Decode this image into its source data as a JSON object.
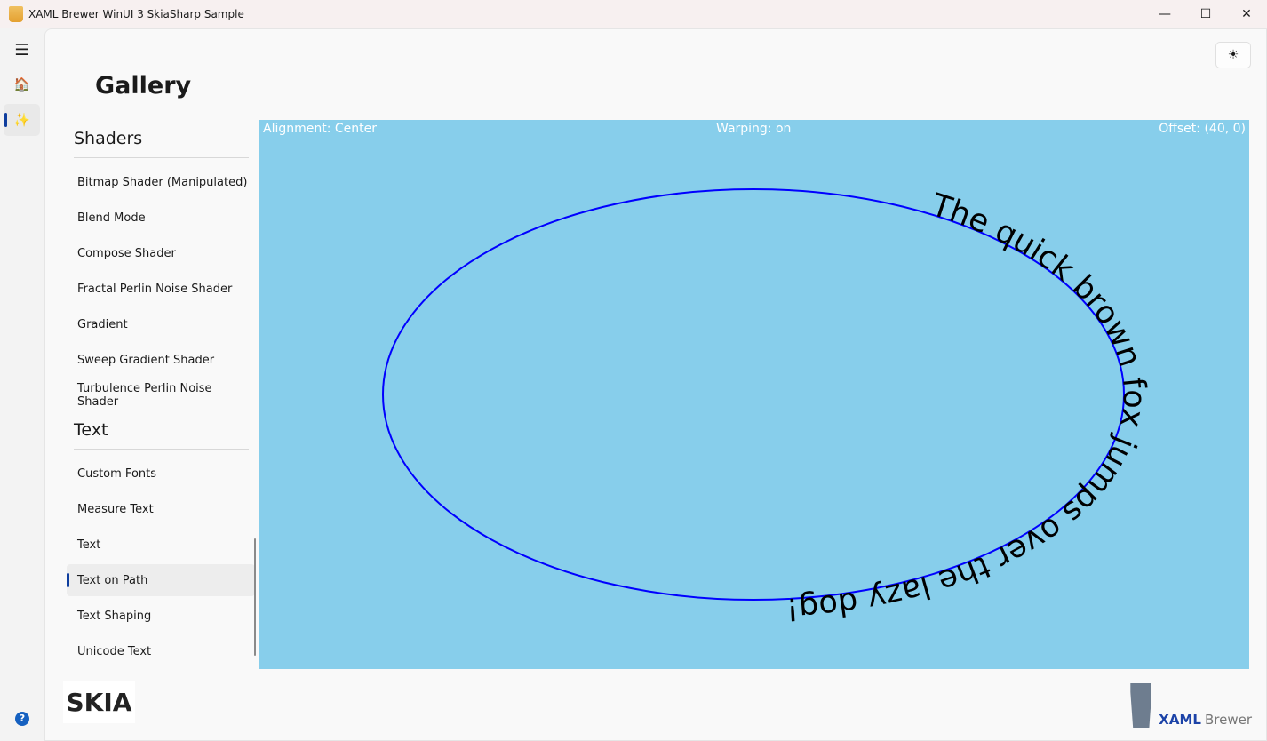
{
  "window": {
    "title": "XAML Brewer WinUI 3 SkiaSharp Sample",
    "minimize": "—",
    "maximize": "☐",
    "close": "✕"
  },
  "nav": {
    "menu": "☰",
    "home": "🏠",
    "gallery": "✨",
    "help": "?"
  },
  "header": {
    "title": "Gallery",
    "theme_icon": "☀"
  },
  "list": {
    "groups": [
      {
        "title": "Shaders",
        "items": [
          "Bitmap Shader (Manipulated)",
          "Blend Mode",
          "Compose Shader",
          "Fractal Perlin Noise Shader",
          "Gradient",
          "Sweep Gradient Shader",
          "Turbulence Perlin Noise Shader"
        ]
      },
      {
        "title": "Text",
        "items": [
          "Custom Fonts",
          "Measure Text",
          "Text",
          "Text on Path",
          "Text Shaping",
          "Unicode Text"
        ]
      }
    ],
    "selected": "Text on Path"
  },
  "canvas": {
    "alignment": "Alignment: Center",
    "warping": "Warping: on",
    "offset": "Offset: (40, 0)",
    "text": "The quick brown fox jumps over the lazy dog!",
    "background": "#87ceeb",
    "path_color": "#0000ff"
  },
  "footer": {
    "skia_logo": "SKIA",
    "brand_bold": "XAML",
    "brand_light": "Brewer"
  }
}
